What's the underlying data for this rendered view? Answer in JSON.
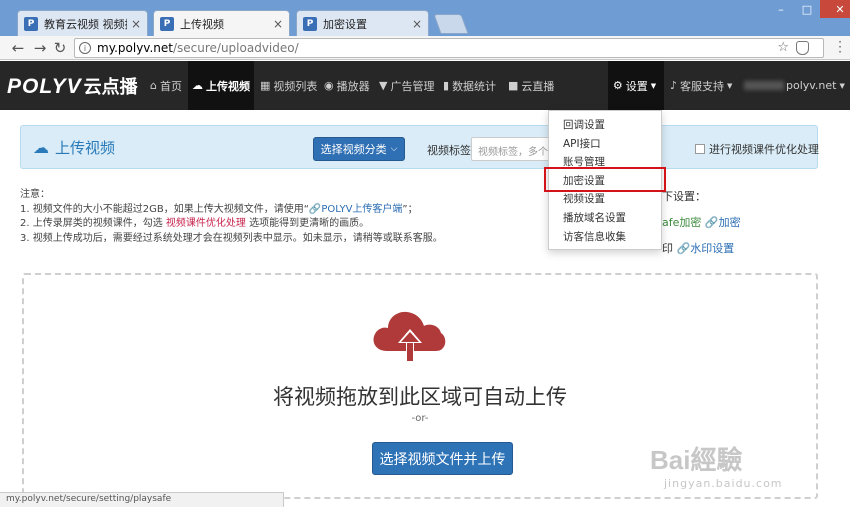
{
  "browser": {
    "tabs": [
      {
        "label": "教育云视频 视频托管 _ (",
        "favicon": "P"
      },
      {
        "label": "上传视频",
        "favicon": "P"
      },
      {
        "label": "加密设置",
        "favicon": "P"
      }
    ],
    "close_glyph": "×",
    "url_host": "my.polyv.net",
    "url_path": "/secure/uploadvideo/",
    "status_url": "my.polyv.net/secure/setting/playsafe",
    "window_controls": {
      "minimize": "–",
      "maximize": "□",
      "close": "✕"
    }
  },
  "nav": {
    "logo": "POLYV",
    "logo_cn": "云点播",
    "items": [
      {
        "label": "首页",
        "icon": "⌂"
      },
      {
        "label": "上传视频",
        "icon": "☁"
      },
      {
        "label": "视频列表",
        "icon": "▦"
      },
      {
        "label": "播放器",
        "icon": "◉"
      },
      {
        "label": "广告管理",
        "icon": "▼"
      },
      {
        "label": "数据统计",
        "icon": "▮"
      },
      {
        "label": "云直播",
        "icon": "■"
      }
    ],
    "settings": "设置",
    "support": "客服支持",
    "account": "polyv.net"
  },
  "panel": {
    "title": "上传视频",
    "category_button": "选择视频分类",
    "tag_label": "视频标签",
    "tag_placeholder": "视频标签，多个",
    "optimize_label": "进行视频课件优化处理"
  },
  "notes": {
    "heading": "注意：",
    "line1_pre": "1. 视频文件的大小不能超过2GB，如果上传大视频文件，请使用“",
    "line1_link": "POLYV上传客户端",
    "line1_post": "”；",
    "line2_pre": "2. 上传录屏类的视频课件，勾选",
    "line2_hl": "视频课件优化处理",
    "line2_post": "选项能得到更清晰的画质。",
    "line3": "3. 视频上传成功后，需要经过系统处理才会在视频列表中显示。如未显示，请稍等或联系客服。"
  },
  "right_notes": {
    "line1": "下设置：",
    "green": "afe加密",
    "link1": "加密",
    "prefix3": "印",
    "link2": "水印设置"
  },
  "dropzone": {
    "text": "将视频拖放到此区域可自动上传",
    "or": "-or-",
    "button": "选择视频文件并上传"
  },
  "dropdown": {
    "items": [
      "回调设置",
      "API接口",
      "账号管理",
      "加密设置",
      "视频设置",
      "播放域名设置",
      "访客信息收集"
    ]
  },
  "watermark": {
    "main": "Bai經驗",
    "sub": "jingyan.baidu.com"
  },
  "colors": {
    "nav_bg": "#272727",
    "accent_blue": "#2f73b7",
    "highlight_red": "#d4121a",
    "cloud_red": "#b03a3a"
  }
}
